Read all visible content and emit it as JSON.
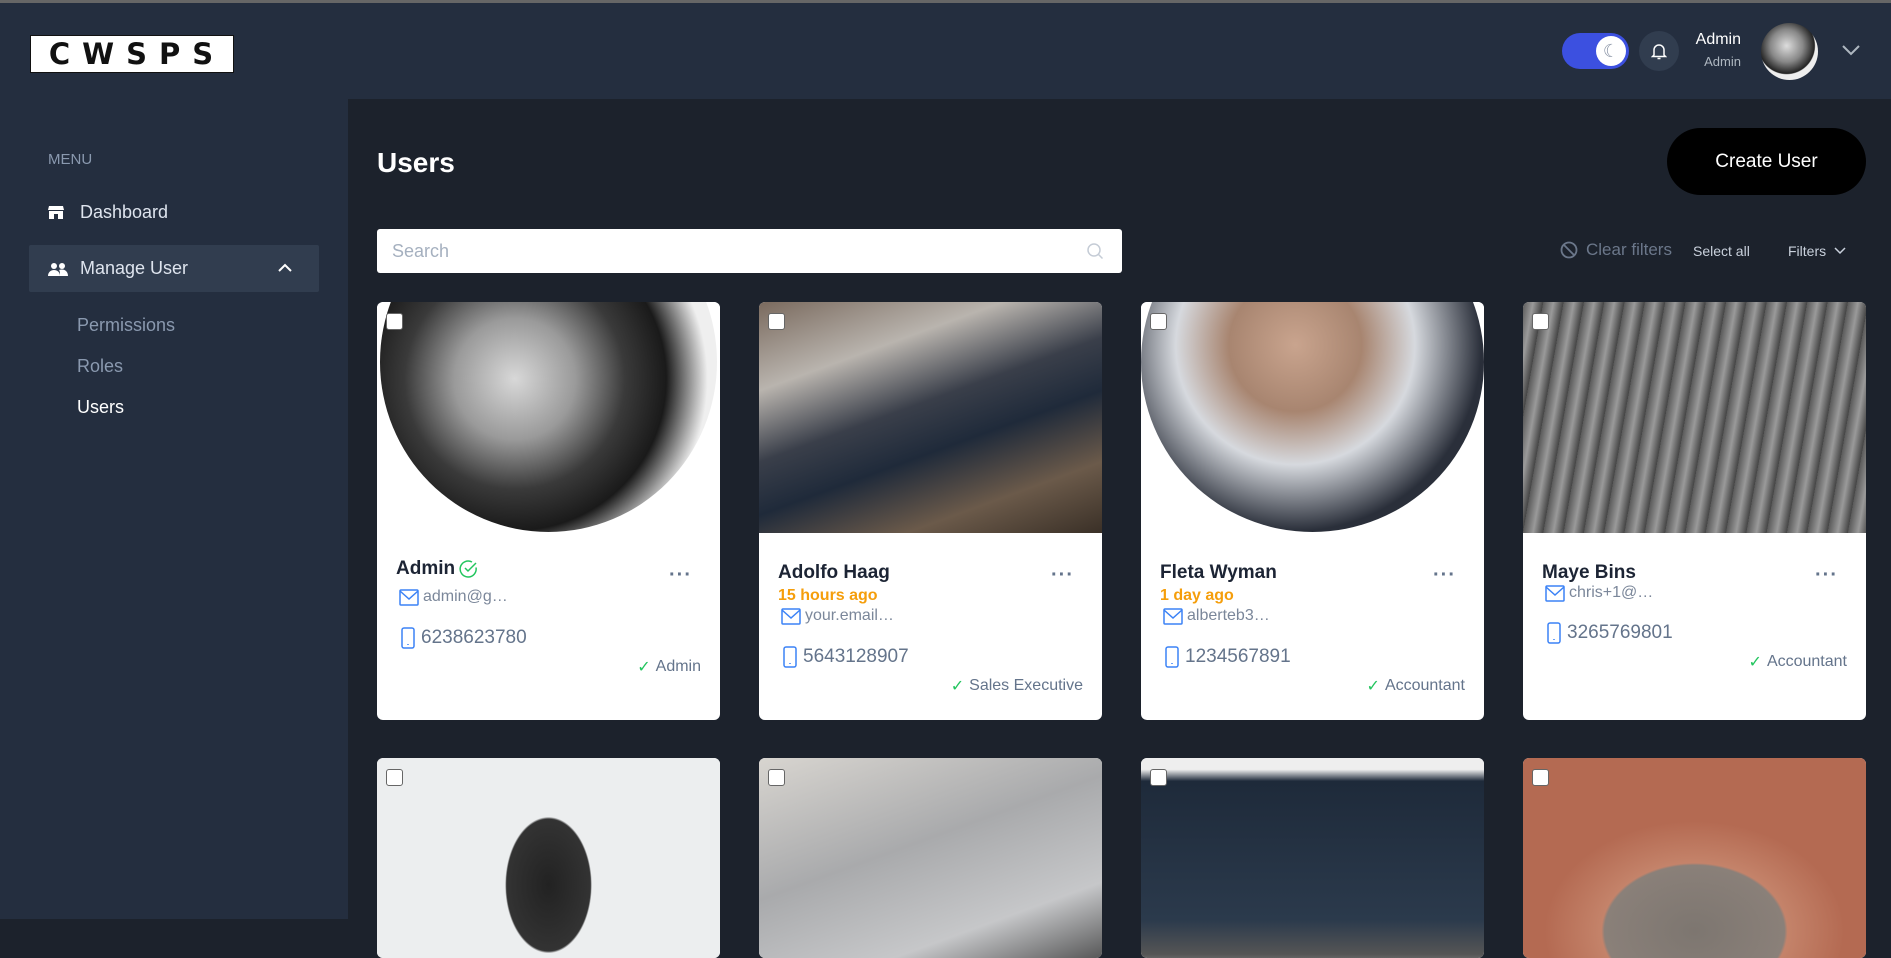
{
  "header": {
    "logo_text": "CWSPS",
    "theme_toggle": {
      "state": "dark",
      "icon": "moon-icon",
      "color": "#3c50e0"
    },
    "notification_icon": "bell-icon",
    "user": {
      "name": "Admin",
      "role": "Admin"
    }
  },
  "sidebar": {
    "menu_label": "MENU",
    "items": [
      {
        "label": "Dashboard",
        "icon": "store-icon"
      },
      {
        "label": "Manage User",
        "icon": "users-icon",
        "expanded": true,
        "children": [
          {
            "label": "Permissions"
          },
          {
            "label": "Roles"
          },
          {
            "label": "Users",
            "active": true
          }
        ]
      }
    ]
  },
  "main": {
    "title": "Users",
    "create_button": "Create User",
    "search_placeholder": "Search",
    "clear_filters": "Clear filters",
    "select_all": "Select all",
    "filters": "Filters",
    "users": [
      {
        "name": "Admin",
        "verified": true,
        "time": "",
        "email": "admin@g…",
        "phone": "6238623780",
        "role": "Admin"
      },
      {
        "name": "Adolfo Haag",
        "time": "15 hours ago",
        "email": "your.email…",
        "phone": "5643128907",
        "role": "Sales Executive"
      },
      {
        "name": "Fleta Wyman",
        "time": "1 day ago",
        "email": "alberteb3…",
        "phone": "1234567891",
        "role": "Accountant"
      },
      {
        "name": "Maye Bins",
        "time": "",
        "email": "chris+1@…",
        "phone": "3265769801",
        "role": "Accountant"
      }
    ],
    "colors": {
      "time": "#f59e0b",
      "check": "#22c55e",
      "icon": "#3b82f6"
    }
  }
}
